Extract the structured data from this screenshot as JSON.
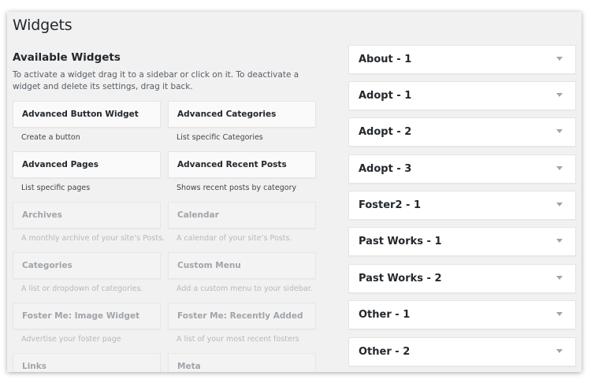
{
  "page": {
    "title": "Widgets"
  },
  "available": {
    "title": "Available Widgets",
    "description": "To activate a widget drag it to a sidebar or click on it. To deactivate a widget and delete its settings, drag it back.",
    "widgets": [
      {
        "title": "Advanced Button Widget",
        "desc": "Create a button"
      },
      {
        "title": "Advanced Categories",
        "desc": "List specific Categories"
      },
      {
        "title": "Advanced Pages",
        "desc": "List specific pages"
      },
      {
        "title": "Advanced Recent Posts",
        "desc": "Shows recent posts by category"
      },
      {
        "title": "Archives",
        "desc": "A monthly archive of your site’s Posts."
      },
      {
        "title": "Calendar",
        "desc": "A calendar of your site’s Posts."
      },
      {
        "title": "Categories",
        "desc": "A list or dropdown of categories."
      },
      {
        "title": "Custom Menu",
        "desc": "Add a custom menu to your sidebar."
      },
      {
        "title": "Foster Me: Image Widget",
        "desc": "Advertise your foster page"
      },
      {
        "title": "Foster Me: Recently Added",
        "desc": "A list of your most recent fosters"
      },
      {
        "title": "Links",
        "desc": ""
      },
      {
        "title": "Meta",
        "desc": ""
      }
    ]
  },
  "sidebars": [
    {
      "name": "About - 1"
    },
    {
      "name": "Adopt - 1"
    },
    {
      "name": "Adopt - 2"
    },
    {
      "name": "Adopt - 3"
    },
    {
      "name": "Foster2 - 1"
    },
    {
      "name": "Past Works - 1"
    },
    {
      "name": "Past Works - 2"
    },
    {
      "name": "Other - 1"
    },
    {
      "name": "Other - 2"
    }
  ]
}
